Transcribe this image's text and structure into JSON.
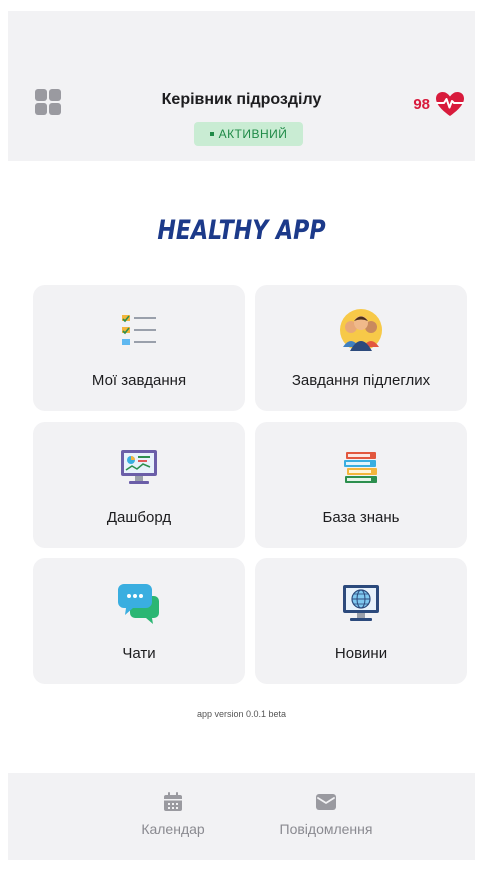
{
  "header": {
    "title": "Керівник підрозділу",
    "status": "АКТИВНИЙ",
    "health_count": "98"
  },
  "app": {
    "title": "HEALTHY APP",
    "version": "app version 0.0.1 beta"
  },
  "tiles": [
    {
      "label": "Мої завдання",
      "icon": "task-list-icon"
    },
    {
      "label": "Завдання підлеглих",
      "icon": "team-icon"
    },
    {
      "label": "Дашборд",
      "icon": "dashboard-monitor-icon"
    },
    {
      "label": "База знань",
      "icon": "books-icon"
    },
    {
      "label": "Чати",
      "icon": "chat-bubbles-icon"
    },
    {
      "label": "Новини",
      "icon": "globe-monitor-icon"
    }
  ],
  "bottom_nav": [
    {
      "label": "Календар",
      "icon": "calendar-icon"
    },
    {
      "label": "Повідомлення",
      "icon": "envelope-icon"
    }
  ],
  "colors": {
    "accent": "#1c3a8a",
    "health": "#d81b3c",
    "status_bg": "#c9ecd3",
    "status_text": "#1f8a47",
    "panel": "#f2f2f4"
  }
}
